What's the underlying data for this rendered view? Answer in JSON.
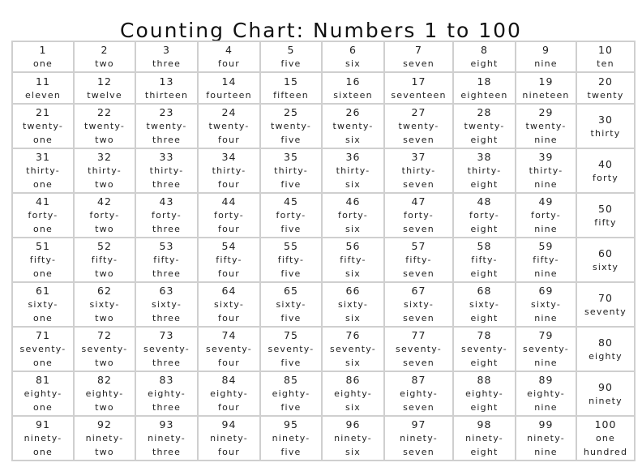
{
  "title": "Counting Chart: Numbers 1 to 100",
  "rows": [
    [
      [
        "1",
        [
          "one"
        ]
      ],
      [
        "2",
        [
          "two"
        ]
      ],
      [
        "3",
        [
          "three"
        ]
      ],
      [
        "4",
        [
          "four"
        ]
      ],
      [
        "5",
        [
          "five"
        ]
      ],
      [
        "6",
        [
          "six"
        ]
      ],
      [
        "7",
        [
          "seven"
        ]
      ],
      [
        "8",
        [
          "eight"
        ]
      ],
      [
        "9",
        [
          "nine"
        ]
      ],
      [
        "10",
        [
          "ten"
        ]
      ]
    ],
    [
      [
        "11",
        [
          "eleven"
        ]
      ],
      [
        "12",
        [
          "twelve"
        ]
      ],
      [
        "13",
        [
          "thirteen"
        ]
      ],
      [
        "14",
        [
          "fourteen"
        ]
      ],
      [
        "15",
        [
          "fifteen"
        ]
      ],
      [
        "16",
        [
          "sixteen"
        ]
      ],
      [
        "17",
        [
          "seventeen"
        ]
      ],
      [
        "18",
        [
          "eighteen"
        ]
      ],
      [
        "19",
        [
          "nineteen"
        ]
      ],
      [
        "20",
        [
          "twenty"
        ]
      ]
    ],
    [
      [
        "21",
        [
          "twenty-",
          "one"
        ]
      ],
      [
        "22",
        [
          "twenty-",
          "two"
        ]
      ],
      [
        "23",
        [
          "twenty-",
          "three"
        ]
      ],
      [
        "24",
        [
          "twenty-",
          "four"
        ]
      ],
      [
        "25",
        [
          "twenty-",
          "five"
        ]
      ],
      [
        "26",
        [
          "twenty-",
          "six"
        ]
      ],
      [
        "27",
        [
          "twenty-",
          "seven"
        ]
      ],
      [
        "28",
        [
          "twenty-",
          "eight"
        ]
      ],
      [
        "29",
        [
          "twenty-",
          "nine"
        ]
      ],
      [
        "30",
        [
          "thirty"
        ]
      ]
    ],
    [
      [
        "31",
        [
          "thirty-",
          "one"
        ]
      ],
      [
        "32",
        [
          "thirty-",
          "two"
        ]
      ],
      [
        "33",
        [
          "thirty-",
          "three"
        ]
      ],
      [
        "34",
        [
          "thirty-",
          "four"
        ]
      ],
      [
        "35",
        [
          "thirty-",
          "five"
        ]
      ],
      [
        "36",
        [
          "thirty-",
          "six"
        ]
      ],
      [
        "37",
        [
          "thirty-",
          "seven"
        ]
      ],
      [
        "38",
        [
          "thirty-",
          "eight"
        ]
      ],
      [
        "39",
        [
          "thirty-",
          "nine"
        ]
      ],
      [
        "40",
        [
          "forty"
        ]
      ]
    ],
    [
      [
        "41",
        [
          "forty-",
          "one"
        ]
      ],
      [
        "42",
        [
          "forty-",
          "two"
        ]
      ],
      [
        "43",
        [
          "forty-",
          "three"
        ]
      ],
      [
        "44",
        [
          "forty-",
          "four"
        ]
      ],
      [
        "45",
        [
          "forty-",
          "five"
        ]
      ],
      [
        "46",
        [
          "forty-",
          "six"
        ]
      ],
      [
        "47",
        [
          "forty-",
          "seven"
        ]
      ],
      [
        "48",
        [
          "forty-",
          "eight"
        ]
      ],
      [
        "49",
        [
          "forty-",
          "nine"
        ]
      ],
      [
        "50",
        [
          "fifty"
        ]
      ]
    ],
    [
      [
        "51",
        [
          "fifty-",
          "one"
        ]
      ],
      [
        "52",
        [
          "fifty-",
          "two"
        ]
      ],
      [
        "53",
        [
          "fifty-",
          "three"
        ]
      ],
      [
        "54",
        [
          "fifty-",
          "four"
        ]
      ],
      [
        "55",
        [
          "fifty-",
          "five"
        ]
      ],
      [
        "56",
        [
          "fifty-",
          "six"
        ]
      ],
      [
        "57",
        [
          "fifty-",
          "seven"
        ]
      ],
      [
        "58",
        [
          "fifty-",
          "eight"
        ]
      ],
      [
        "59",
        [
          "fifty-",
          "nine"
        ]
      ],
      [
        "60",
        [
          "sixty"
        ]
      ]
    ],
    [
      [
        "61",
        [
          "sixty-",
          "one"
        ]
      ],
      [
        "62",
        [
          "sixty-",
          "two"
        ]
      ],
      [
        "63",
        [
          "sixty-",
          "three"
        ]
      ],
      [
        "64",
        [
          "sixty-",
          "four"
        ]
      ],
      [
        "65",
        [
          "sixty-",
          "five"
        ]
      ],
      [
        "66",
        [
          "sixty-",
          "six"
        ]
      ],
      [
        "67",
        [
          "sixty-",
          "seven"
        ]
      ],
      [
        "68",
        [
          "sixty-",
          "eight"
        ]
      ],
      [
        "69",
        [
          "sixty-",
          "nine"
        ]
      ],
      [
        "70",
        [
          "seventy"
        ]
      ]
    ],
    [
      [
        "71",
        [
          "seventy-",
          "one"
        ]
      ],
      [
        "72",
        [
          "seventy-",
          "two"
        ]
      ],
      [
        "73",
        [
          "seventy-",
          "three"
        ]
      ],
      [
        "74",
        [
          "seventy-",
          "four"
        ]
      ],
      [
        "75",
        [
          "seventy-",
          "five"
        ]
      ],
      [
        "76",
        [
          "seventy-",
          "six"
        ]
      ],
      [
        "77",
        [
          "seventy-",
          "seven"
        ]
      ],
      [
        "78",
        [
          "seventy-",
          "eight"
        ]
      ],
      [
        "79",
        [
          "seventy-",
          "nine"
        ]
      ],
      [
        "80",
        [
          "eighty"
        ]
      ]
    ],
    [
      [
        "81",
        [
          "eighty-",
          "one"
        ]
      ],
      [
        "82",
        [
          "eighty-",
          "two"
        ]
      ],
      [
        "83",
        [
          "eighty-",
          "three"
        ]
      ],
      [
        "84",
        [
          "eighty-",
          "four"
        ]
      ],
      [
        "85",
        [
          "eighty-",
          "five"
        ]
      ],
      [
        "86",
        [
          "eighty-",
          "six"
        ]
      ],
      [
        "87",
        [
          "eighty-",
          "seven"
        ]
      ],
      [
        "88",
        [
          "eighty-",
          "eight"
        ]
      ],
      [
        "89",
        [
          "eighty-",
          "nine"
        ]
      ],
      [
        "90",
        [
          "ninety"
        ]
      ]
    ],
    [
      [
        "91",
        [
          "ninety-",
          "one"
        ]
      ],
      [
        "92",
        [
          "ninety-",
          "two"
        ]
      ],
      [
        "93",
        [
          "ninety-",
          "three"
        ]
      ],
      [
        "94",
        [
          "ninety-",
          "four"
        ]
      ],
      [
        "95",
        [
          "ninety-",
          "five"
        ]
      ],
      [
        "96",
        [
          "ninety-",
          "six"
        ]
      ],
      [
        "97",
        [
          "ninety-",
          "seven"
        ]
      ],
      [
        "98",
        [
          "ninety-",
          "eight"
        ]
      ],
      [
        "99",
        [
          "ninety-",
          "nine"
        ]
      ],
      [
        "100",
        [
          "one",
          "hundred"
        ]
      ]
    ]
  ]
}
